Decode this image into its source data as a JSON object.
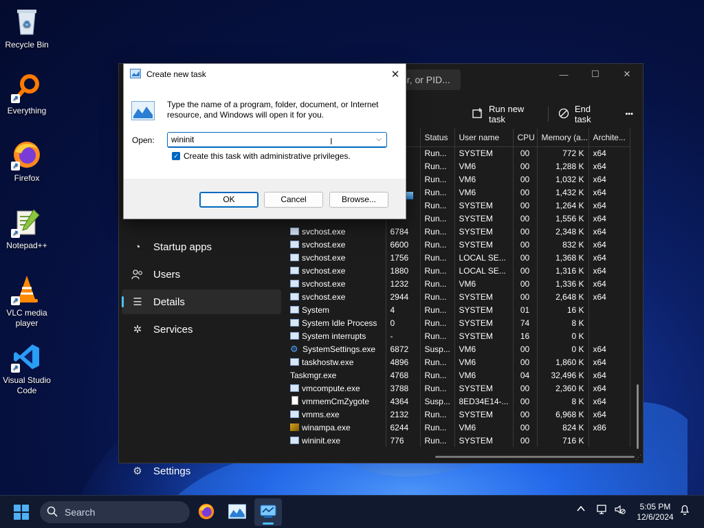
{
  "desktop": {
    "icons": [
      {
        "label": "Recycle Bin",
        "icon": "recycle-bin-icon"
      },
      {
        "label": "Everything",
        "icon": "search-magnifier-icon"
      },
      {
        "label": "Firefox",
        "icon": "firefox-icon"
      },
      {
        "label": "Notepad++",
        "icon": "notepad-plus-plus-icon"
      },
      {
        "label": "VLC media player",
        "icon": "vlc-cone-icon"
      },
      {
        "label": "Visual Studio Code",
        "icon": "vscode-icon"
      }
    ]
  },
  "task_manager": {
    "search_placeholder": "er, or PID...",
    "commands": {
      "run_new_task": "Run new task",
      "end_task": "End task",
      "more": "•••"
    },
    "nav": [
      {
        "label": "Startup apps",
        "icon": "startup-apps-icon"
      },
      {
        "label": "Users",
        "icon": "users-icon"
      },
      {
        "label": "Details",
        "icon": "details-list-icon"
      },
      {
        "label": "Services",
        "icon": "services-icon"
      },
      {
        "label": "Settings",
        "icon": "settings-gear-icon"
      }
    ],
    "columns": {
      "status": "Status",
      "user": "User name",
      "cpu": "CPU",
      "memory": "Memory (a...",
      "arch": "Archite..."
    },
    "rows": [
      {
        "name": "",
        "pid": "",
        "status": "Run...",
        "user": "SYSTEM",
        "cpu": "00",
        "memory": "772 K",
        "arch": "x64",
        "icon": "none"
      },
      {
        "name": "",
        "pid": "",
        "status": "Run...",
        "user": "VM6",
        "cpu": "00",
        "memory": "1,288 K",
        "arch": "x64",
        "icon": "none"
      },
      {
        "name": "",
        "pid": "",
        "status": "Run...",
        "user": "VM6",
        "cpu": "00",
        "memory": "1,032 K",
        "arch": "x64",
        "icon": "none"
      },
      {
        "name": "",
        "pid": "",
        "status": "Run...",
        "user": "VM6",
        "cpu": "00",
        "memory": "1,432 K",
        "arch": "x64",
        "icon": "none"
      },
      {
        "name": "",
        "pid": "",
        "status": "Run...",
        "user": "SYSTEM",
        "cpu": "00",
        "memory": "1,264 K",
        "arch": "x64",
        "icon": "none"
      },
      {
        "name": "",
        "pid": "",
        "status": "Run...",
        "user": "SYSTEM",
        "cpu": "00",
        "memory": "1,556 K",
        "arch": "x64",
        "icon": "none"
      },
      {
        "name": "svchost.exe",
        "pid": "6784",
        "status": "Run...",
        "user": "SYSTEM",
        "cpu": "00",
        "memory": "2,348 K",
        "arch": "x64",
        "icon": "app"
      },
      {
        "name": "svchost.exe",
        "pid": "6600",
        "status": "Run...",
        "user": "SYSTEM",
        "cpu": "00",
        "memory": "832 K",
        "arch": "x64",
        "icon": "app"
      },
      {
        "name": "svchost.exe",
        "pid": "1756",
        "status": "Run...",
        "user": "LOCAL SE...",
        "cpu": "00",
        "memory": "1,368 K",
        "arch": "x64",
        "icon": "app"
      },
      {
        "name": "svchost.exe",
        "pid": "1880",
        "status": "Run...",
        "user": "LOCAL SE...",
        "cpu": "00",
        "memory": "1,316 K",
        "arch": "x64",
        "icon": "app"
      },
      {
        "name": "svchost.exe",
        "pid": "1232",
        "status": "Run...",
        "user": "VM6",
        "cpu": "00",
        "memory": "1,336 K",
        "arch": "x64",
        "icon": "app"
      },
      {
        "name": "svchost.exe",
        "pid": "2944",
        "status": "Run...",
        "user": "SYSTEM",
        "cpu": "00",
        "memory": "2,648 K",
        "arch": "x64",
        "icon": "app"
      },
      {
        "name": "System",
        "pid": "4",
        "status": "Run...",
        "user": "SYSTEM",
        "cpu": "01",
        "memory": "16 K",
        "arch": "",
        "icon": "app"
      },
      {
        "name": "System Idle Process",
        "pid": "0",
        "status": "Run...",
        "user": "SYSTEM",
        "cpu": "74",
        "memory": "8 K",
        "arch": "",
        "icon": "app"
      },
      {
        "name": "System interrupts",
        "pid": "-",
        "status": "Run...",
        "user": "SYSTEM",
        "cpu": "16",
        "memory": "0 K",
        "arch": "",
        "icon": "app"
      },
      {
        "name": "SystemSettings.exe",
        "pid": "6872",
        "status": "Susp...",
        "user": "VM6",
        "cpu": "00",
        "memory": "0 K",
        "arch": "x64",
        "icon": "gear"
      },
      {
        "name": "taskhostw.exe",
        "pid": "4896",
        "status": "Run...",
        "user": "VM6",
        "cpu": "00",
        "memory": "1,860 K",
        "arch": "x64",
        "icon": "app"
      },
      {
        "name": "Taskmgr.exe",
        "pid": "4768",
        "status": "Run...",
        "user": "VM6",
        "cpu": "04",
        "memory": "32,496 K",
        "arch": "x64",
        "icon": "tm"
      },
      {
        "name": "vmcompute.exe",
        "pid": "3788",
        "status": "Run...",
        "user": "SYSTEM",
        "cpu": "00",
        "memory": "2,360 K",
        "arch": "x64",
        "icon": "app"
      },
      {
        "name": "vmmemCmZygote",
        "pid": "4364",
        "status": "Susp...",
        "user": "8ED34E14-...",
        "cpu": "00",
        "memory": "8 K",
        "arch": "x64",
        "icon": "doc"
      },
      {
        "name": "vmms.exe",
        "pid": "2132",
        "status": "Run...",
        "user": "SYSTEM",
        "cpu": "00",
        "memory": "6,968 K",
        "arch": "x64",
        "icon": "app"
      },
      {
        "name": "winampa.exe",
        "pid": "6244",
        "status": "Run...",
        "user": "VM6",
        "cpu": "00",
        "memory": "824 K",
        "arch": "x86",
        "icon": "amp"
      },
      {
        "name": "wininit.exe",
        "pid": "776",
        "status": "Run...",
        "user": "SYSTEM",
        "cpu": "00",
        "memory": "716 K",
        "arch": "",
        "icon": "app"
      }
    ]
  },
  "dialog": {
    "title": "Create new task",
    "description": "Type the name of a program, folder, document, or Internet resource, and Windows will open it for you.",
    "open_label": "Open:",
    "open_value": "wininit",
    "admin_checkbox_label": "Create this task with administrative privileges.",
    "admin_checked": true,
    "ok": "OK",
    "cancel": "Cancel",
    "browse": "Browse..."
  },
  "taskbar": {
    "search_label": "Search",
    "apps": [
      "firefox-icon",
      "run-dialog-icon",
      "task-manager-icon"
    ],
    "time": "5:05 PM",
    "date": "12/6/2024"
  },
  "colors": {
    "accent": "#0067c0",
    "nav_accent": "#4cc2ff",
    "tm_bg": "#1c1c1c"
  }
}
